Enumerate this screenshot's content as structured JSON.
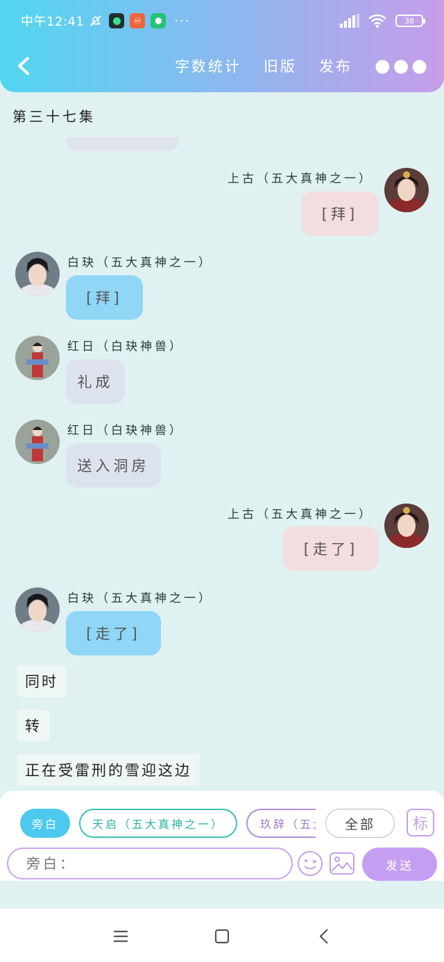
{
  "status_bar": {
    "time": "中午12:41",
    "more": "···",
    "battery": "38"
  },
  "nav": {
    "word_count": "字数统计",
    "old_version": "旧版",
    "publish": "发布",
    "more": "●●●"
  },
  "episode_title": "第三十七集",
  "messages": [
    {
      "speaker": "上古（五大真神之一）",
      "text": "[拜]"
    },
    {
      "speaker": "白玦（五大真神之一）",
      "text": "[拜]"
    },
    {
      "speaker": "红日（白玦神兽）",
      "text": "礼成"
    },
    {
      "speaker": "红日（白玦神兽）",
      "text": "送入洞房"
    },
    {
      "speaker": "上古（五大真神之一）",
      "text": "[走了]"
    },
    {
      "speaker": "白玦（五大真神之一）",
      "text": "[走了]"
    }
  ],
  "narrations": [
    "同时",
    "转",
    "正在受雷刑的雪迎这边"
  ],
  "roles": {
    "active": "旁白",
    "tianqi": "天启（五大真神之一）",
    "jiuci": "玖辞（五大",
    "all": "全部",
    "mark": "标"
  },
  "input": {
    "placeholder": "旁白："
  },
  "send_label": "发送",
  "icons": {
    "back": "chevron-left-icon",
    "emoji": "smiley-face-icon",
    "image": "image-icon",
    "menu": "menu-icon",
    "home": "square-home-icon",
    "sys_back": "system-back-icon"
  },
  "colors": {
    "header_gradient_start": "#52d6f0",
    "header_gradient_end": "#c79de9",
    "bubble_pink": "#f2dede",
    "bubble_blue": "#8fd6f7",
    "bubble_gray": "#dde3ee",
    "accent_purple": "#c49ef0",
    "accent_teal": "#38c2b5",
    "background": "#e0f1f1"
  }
}
